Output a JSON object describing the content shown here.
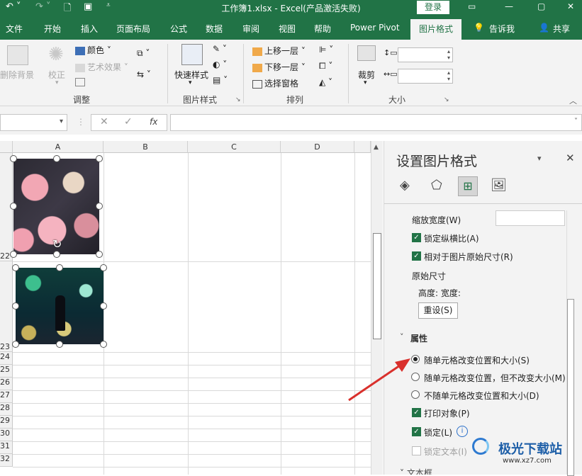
{
  "titlebar": {
    "title": "工作簿1.xlsx  -  Excel(产品激活失败)",
    "login": "登录"
  },
  "tabs": [
    "文件",
    "开始",
    "插入",
    "页面布局",
    "公式",
    "数据",
    "审阅",
    "视图",
    "帮助",
    "Power Pivot",
    "图片格式",
    "告诉我",
    "共享"
  ],
  "ribbon": {
    "remove_bg": "删除背景",
    "correct": "校正",
    "color": "颜色",
    "art_effect": "艺术效果",
    "group_adjust": "调整",
    "quick_style": "快速样式",
    "group_pic_style": "图片样式",
    "bring_forward": "上移一层",
    "send_backward": "下移一层",
    "selection_pane": "选择窗格",
    "group_arrange": "排列",
    "crop": "裁剪",
    "group_size": "大小"
  },
  "formula": {
    "fx": "fx",
    "cancel": "✕",
    "enter": "✓"
  },
  "columns": [
    "A",
    "B",
    "C",
    "D"
  ],
  "rows": [
    "22",
    "23",
    "24",
    "25",
    "26",
    "27",
    "28",
    "29",
    "30",
    "31",
    "32"
  ],
  "panel": {
    "title": "设置图片格式",
    "scale_width": "缩放宽度(W)",
    "lock_aspect": "锁定纵横比(A)",
    "relative_original": "相对于图片原始尺寸(R)",
    "original_size": "原始尺寸",
    "height_width": "高度:   宽度:",
    "reset": "重设(S)",
    "props": "属性",
    "opt1": "随单元格改变位置和大小(S)",
    "opt2": "随单元格改变位置，但不改变大小(M)",
    "opt3": "不随单元格改变位置和大小(D)",
    "print_obj": "打印对象(P)",
    "lock": "锁定(L)",
    "lock_text": "锁定文本(I)",
    "text_frame": "文本框"
  },
  "watermark": {
    "brand": "极光下载站",
    "url": "www.xz7.com"
  },
  "colors": {
    "excel_green": "#217346",
    "arrow_red": "#d9302c"
  }
}
